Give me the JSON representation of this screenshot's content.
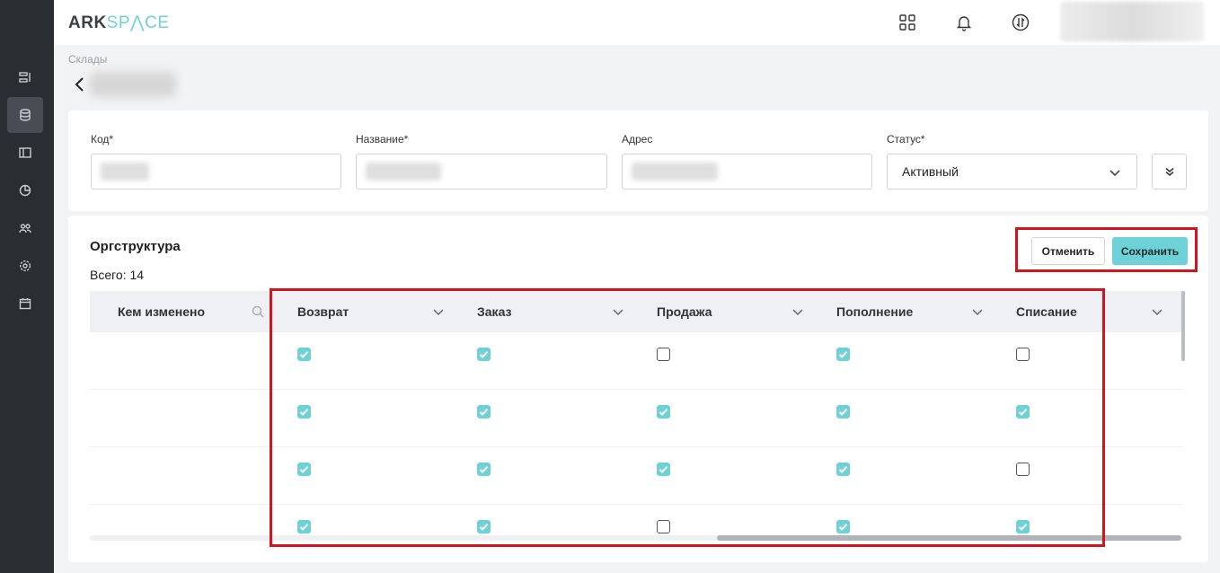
{
  "app": {
    "logo_main": "ARK",
    "logo_accent": "SP⋀CE"
  },
  "sidebar": {
    "items": [
      {
        "name": "list-icon"
      },
      {
        "name": "database-icon",
        "active": true
      },
      {
        "name": "book-icon"
      },
      {
        "name": "chart-icon"
      },
      {
        "name": "users-icon"
      },
      {
        "name": "gear-icon"
      },
      {
        "name": "calendar-icon"
      }
    ]
  },
  "header": {
    "icons": [
      "apps-icon",
      "bell-icon",
      "exchange-icon"
    ]
  },
  "breadcrumb": {
    "label": "Склады"
  },
  "form": {
    "code_label": "Код*",
    "name_label": "Название*",
    "address_label": "Адрес",
    "status_label": "Статус*",
    "status_value": "Активный"
  },
  "org": {
    "title": "Оргструктура",
    "total": "Всего: 14",
    "cancel_label": "Отменить",
    "save_label": "Сохранить",
    "columns": [
      "Кем изменено",
      "Возврат",
      "Заказ",
      "Продажа",
      "Пополнение",
      "Списание"
    ],
    "rows": [
      [
        true,
        true,
        false,
        true,
        false
      ],
      [
        true,
        true,
        true,
        true,
        true
      ],
      [
        true,
        true,
        true,
        true,
        false
      ],
      [
        true,
        true,
        false,
        true,
        true
      ]
    ]
  },
  "colors": {
    "accent": "#6fd1d8",
    "highlight": "#d4141c",
    "sidebar": "#2a2d31"
  }
}
